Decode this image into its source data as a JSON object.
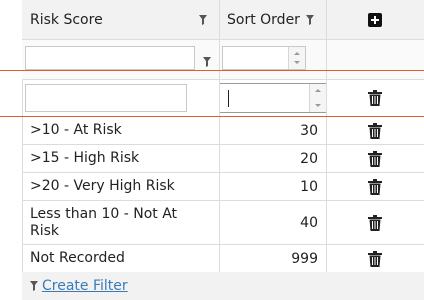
{
  "header": {
    "col_risk_score": "Risk Score",
    "col_sort_order": "Sort Order",
    "add_icon": "plus-square-icon"
  },
  "filter": {
    "risk_score_value": "",
    "sort_order_value": ""
  },
  "edit_row": {
    "risk_score_value": "",
    "sort_order_value": ""
  },
  "rows": [
    {
      "risk_score": ">10 - At Risk",
      "sort_order": "30"
    },
    {
      "risk_score": ">15 - High Risk",
      "sort_order": "20"
    },
    {
      "risk_score": ">20 - Very High Risk",
      "sort_order": "10"
    },
    {
      "risk_score": "Less than 10 - Not At Risk",
      "sort_order": "40"
    },
    {
      "risk_score": "Not Recorded",
      "sort_order": "999"
    }
  ],
  "footer": {
    "create_filter_label": "Create Filter"
  },
  "colors": {
    "highlight": "#e05a36",
    "link": "#3a7ab8"
  }
}
